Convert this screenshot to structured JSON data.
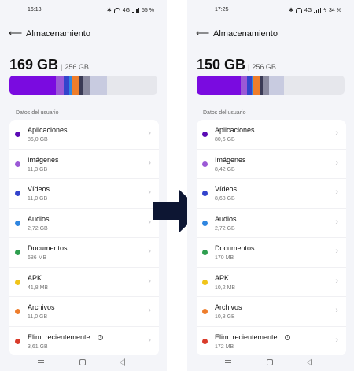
{
  "screens": [
    {
      "status": {
        "time": "16:18",
        "network": "4G",
        "battery": "55 %"
      },
      "title": "Almacenamiento",
      "used": "169 GB",
      "total": "256 GB",
      "section": "Datos del usuario",
      "items": [
        {
          "name": "Aplicaciones",
          "size": "86,0 GB",
          "color": "#5b0bb5"
        },
        {
          "name": "Imágenes",
          "size": "11,3 GB",
          "color": "#9b59d6"
        },
        {
          "name": "Vídeos",
          "size": "11,0 GB",
          "color": "#3344cc"
        },
        {
          "name": "Audios",
          "size": "2,72 GB",
          "color": "#2f86e0"
        },
        {
          "name": "Documentos",
          "size": "686 MB",
          "color": "#2e9e4f"
        },
        {
          "name": "APK",
          "size": "41,8 MB",
          "color": "#f0c419"
        },
        {
          "name": "Archivos",
          "size": "11,0 GB",
          "color": "#ee7d2b"
        },
        {
          "name": "Elim. recientemente",
          "size": "3,61 GB",
          "color": "#d93b2a",
          "info": "i"
        }
      ],
      "bar_segments": [
        {
          "fraction": 0.315,
          "color": "#7a0be0"
        },
        {
          "fraction": 0.05,
          "color": "#9b59d6"
        },
        {
          "fraction": 0.04,
          "color": "#3344cc"
        },
        {
          "fraction": 0.015,
          "color": "#2f86e0"
        },
        {
          "fraction": 0.055,
          "color": "#ee7d2b"
        },
        {
          "fraction": 0.02,
          "color": "#3a3a55"
        },
        {
          "fraction": 0.05,
          "color": "#8a8aa0"
        },
        {
          "fraction": 0.115,
          "color": "#c8cbe0"
        }
      ]
    },
    {
      "status": {
        "time": "17:25",
        "network": "4G",
        "battery": "34 %"
      },
      "title": "Almacenamiento",
      "used": "150 GB",
      "total": "256 GB",
      "section": "Datos del usuario",
      "items": [
        {
          "name": "Aplicaciones",
          "size": "80,6 GB",
          "color": "#5b0bb5"
        },
        {
          "name": "Imágenes",
          "size": "8,42 GB",
          "color": "#9b59d6"
        },
        {
          "name": "Vídeos",
          "size": "8,68 GB",
          "color": "#3344cc"
        },
        {
          "name": "Audios",
          "size": "2,72 GB",
          "color": "#2f86e0"
        },
        {
          "name": "Documentos",
          "size": "170 MB",
          "color": "#2e9e4f"
        },
        {
          "name": "APK",
          "size": "10,2 MB",
          "color": "#f0c419"
        },
        {
          "name": "Archivos",
          "size": "10,8 GB",
          "color": "#ee7d2b"
        },
        {
          "name": "Elim. recientemente",
          "size": "172 MB",
          "color": "#d93b2a",
          "info": "i"
        }
      ],
      "bar_segments": [
        {
          "fraction": 0.3,
          "color": "#7a0be0"
        },
        {
          "fraction": 0.04,
          "color": "#9b59d6"
        },
        {
          "fraction": 0.03,
          "color": "#3344cc"
        },
        {
          "fraction": 0.01,
          "color": "#2f86e0"
        },
        {
          "fraction": 0.05,
          "color": "#ee7d2b"
        },
        {
          "fraction": 0.015,
          "color": "#3a3a55"
        },
        {
          "fraction": 0.045,
          "color": "#8a8aa0"
        },
        {
          "fraction": 0.1,
          "color": "#c8cbe0"
        }
      ]
    }
  ],
  "arrow_color": "#0d1633"
}
